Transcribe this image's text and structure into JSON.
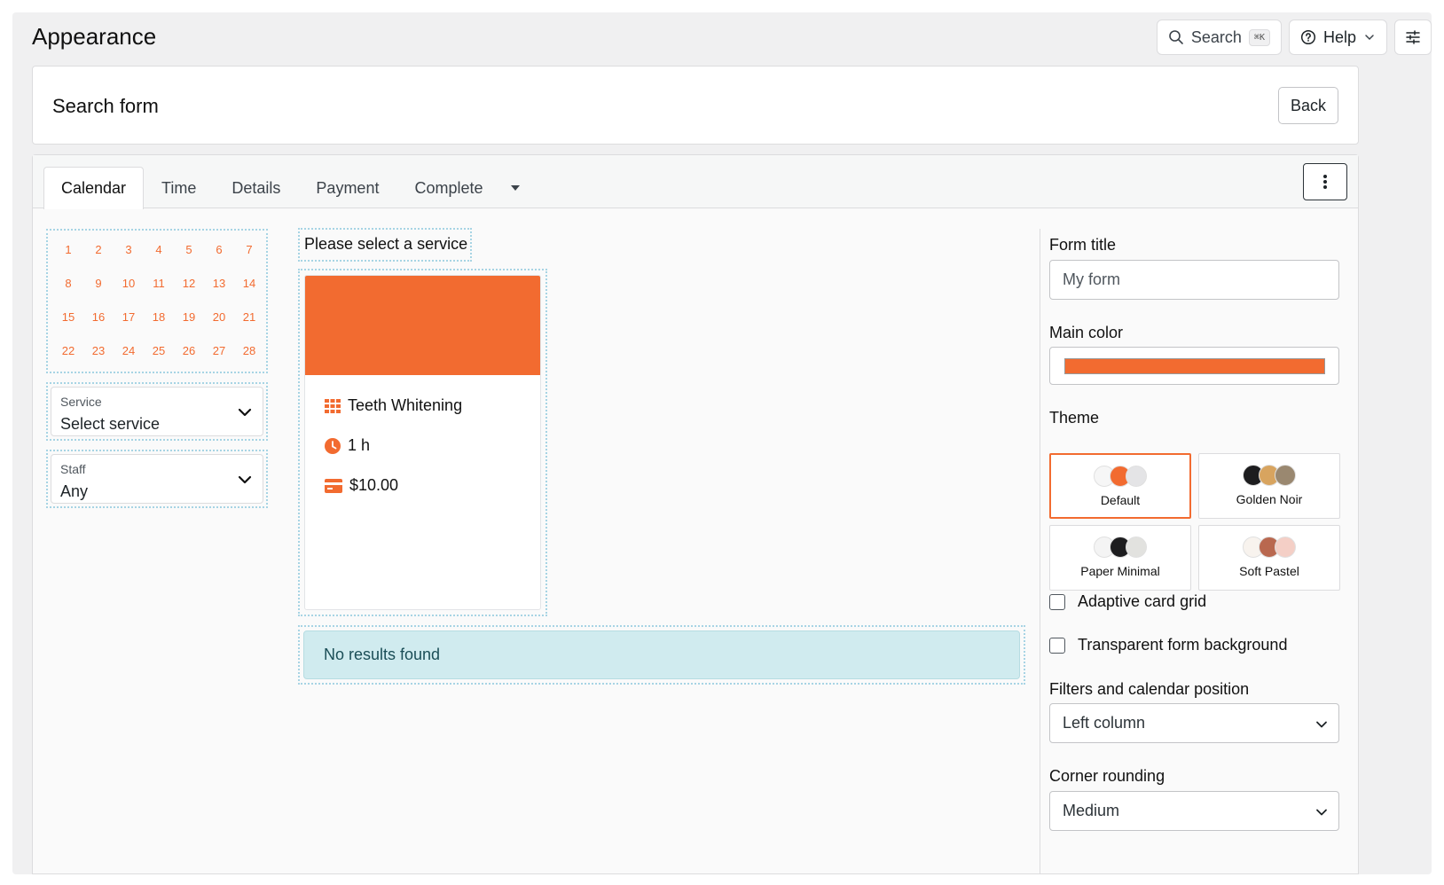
{
  "page": {
    "title": "Appearance"
  },
  "top_actions": {
    "search_label": "Search",
    "search_shortcut": "⌘K",
    "help_label": "Help"
  },
  "header": {
    "title": "Search form",
    "back_label": "Back"
  },
  "tabs": [
    "Calendar",
    "Time",
    "Details",
    "Payment",
    "Complete"
  ],
  "calendar": {
    "days": [
      "1",
      "2",
      "3",
      "4",
      "5",
      "6",
      "7",
      "8",
      "9",
      "10",
      "11",
      "12",
      "13",
      "14",
      "15",
      "16",
      "17",
      "18",
      "19",
      "20",
      "21",
      "22",
      "23",
      "24",
      "25",
      "26",
      "27",
      "28"
    ],
    "accent": "#f26b30"
  },
  "filters": {
    "service_label": "Service",
    "service_value": "Select service",
    "staff_label": "Staff",
    "staff_value": "Any"
  },
  "services": {
    "heading": "Please select a service",
    "card": {
      "image_color": "#f26b30",
      "name": "Teeth Whitening",
      "duration": "1 h",
      "price": "$10.00"
    },
    "no_results": "No results found"
  },
  "settings": {
    "form_title_label": "Form title",
    "form_title_value": "My form",
    "main_color_label": "Main color",
    "main_color_value": "#f26b30",
    "theme_label": "Theme",
    "themes": [
      {
        "name": "Default",
        "colors": [
          "#f6f6f6",
          "#f26b30",
          "#e4e4e6"
        ],
        "selected": true
      },
      {
        "name": "Golden Noir",
        "colors": [
          "#1d1d1f",
          "#d8a45f",
          "#9a8870"
        ],
        "selected": false
      },
      {
        "name": "Paper Minimal",
        "colors": [
          "#f4f4f4",
          "#1d1d1f",
          "#e2e2df"
        ],
        "selected": false
      },
      {
        "name": "Soft Pastel",
        "colors": [
          "#f8f3ee",
          "#b9684f",
          "#f4cfc6"
        ],
        "selected": false
      }
    ],
    "adaptive_grid_label": "Adaptive card grid",
    "transparent_bg_label": "Transparent form background",
    "filters_position_label": "Filters and calendar position",
    "filters_position_value": "Left column",
    "corner_rounding_label": "Corner rounding",
    "corner_rounding_value": "Medium"
  }
}
